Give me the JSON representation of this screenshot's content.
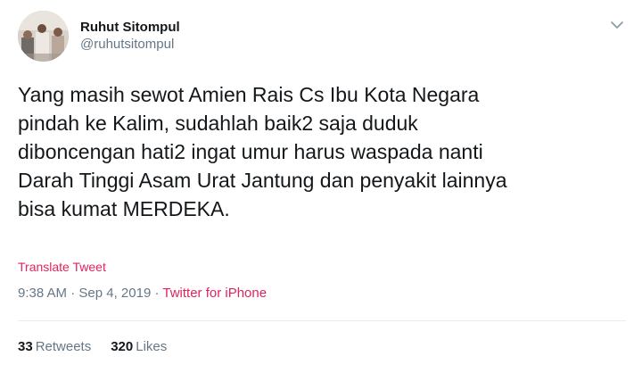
{
  "author": {
    "display_name": "Ruhut Sitompul",
    "handle": "@ruhutsitompul"
  },
  "tweet": {
    "text": "Yang masih sewot Amien Rais Cs Ibu Kota Negara\npindah ke Kalim, sudahlah baik2 saja duduk\ndiboncengan hati2 ingat umur harus waspada nanti\nDarah Tinggi Asam Urat Jantung dan penyakit lainnya\nbisa kumat MERDEKA.",
    "translate_label": "Translate Tweet",
    "time": "9:38 AM",
    "date": "Sep 4, 2019",
    "separator": " · ",
    "source": "Twitter for iPhone"
  },
  "stats": {
    "retweets_count": "33",
    "retweets_label": "Retweets",
    "likes_count": "320",
    "likes_label": "Likes"
  },
  "icons": {
    "caret": "chevron-down-icon",
    "avatar": "avatar"
  },
  "colors": {
    "text": "#14171a",
    "secondary": "#657786",
    "accent": "#e0245e",
    "divider": "#e6ecf0"
  }
}
